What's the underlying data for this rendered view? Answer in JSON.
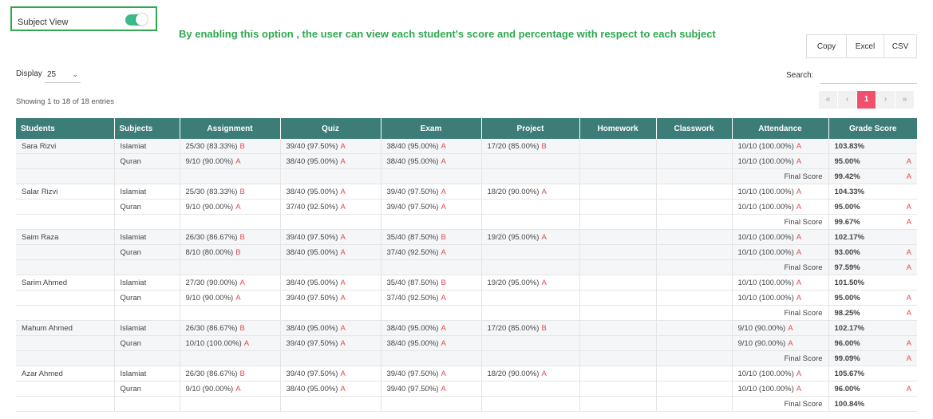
{
  "subject_view": {
    "label": "Subject View",
    "enabled": true
  },
  "annotation": "By enabling this option , the user can view each student's score and percentage with respect to each subject",
  "export": {
    "copy": "Copy",
    "excel": "Excel",
    "csv": "CSV"
  },
  "display": {
    "label": "Display",
    "value": "25"
  },
  "search": {
    "label": "Search:",
    "value": ""
  },
  "entries_info": "Showing 1 to 18 of 18 entries",
  "pagination": {
    "first": "«",
    "prev": "‹",
    "current": "1",
    "next": "›",
    "last": "»"
  },
  "colors": {
    "header_bg": "#3d7d78",
    "accent_green": "#3dba8a",
    "grade_red": "#e5484d",
    "active_page": "#f0506e"
  },
  "table": {
    "headers": [
      "Students",
      "Subjects",
      "Assignment",
      "Quiz",
      "Exam",
      "Project",
      "Homework",
      "Classwork",
      "Attendance",
      "Grade Score"
    ],
    "final_label": "Final Score",
    "students": [
      {
        "name": "Sara Rizvi",
        "final_score": "99.42%",
        "final_grade": "A",
        "rows": [
          {
            "subject": "Islamiat",
            "assignment": "25/30 (83.33%)",
            "assignment_g": "B",
            "quiz": "39/40 (97.50%)",
            "quiz_g": "A",
            "exam": "38/40 (95.00%)",
            "exam_g": "A",
            "project": "17/20 (85.00%)",
            "project_g": "B",
            "attendance": "10/10 (100.00%)",
            "attendance_g": "A",
            "score": "103.83%",
            "grade": ""
          },
          {
            "subject": "Quran",
            "assignment": "9/10 (90.00%)",
            "assignment_g": "A",
            "quiz": "38/40 (95.00%)",
            "quiz_g": "A",
            "exam": "38/40 (95.00%)",
            "exam_g": "A",
            "project": "",
            "project_g": "",
            "attendance": "10/10 (100.00%)",
            "attendance_g": "A",
            "score": "95.00%",
            "grade": "A"
          }
        ]
      },
      {
        "name": "Salar Rizvi",
        "final_score": "99.67%",
        "final_grade": "A",
        "rows": [
          {
            "subject": "Islamiat",
            "assignment": "25/30 (83.33%)",
            "assignment_g": "B",
            "quiz": "38/40 (95.00%)",
            "quiz_g": "A",
            "exam": "39/40 (97.50%)",
            "exam_g": "A",
            "project": "18/20 (90.00%)",
            "project_g": "A",
            "attendance": "10/10 (100.00%)",
            "attendance_g": "A",
            "score": "104.33%",
            "grade": ""
          },
          {
            "subject": "Quran",
            "assignment": "9/10 (90.00%)",
            "assignment_g": "A",
            "quiz": "37/40 (92.50%)",
            "quiz_g": "A",
            "exam": "39/40 (97.50%)",
            "exam_g": "A",
            "project": "",
            "project_g": "",
            "attendance": "10/10 (100.00%)",
            "attendance_g": "A",
            "score": "95.00%",
            "grade": "A"
          }
        ]
      },
      {
        "name": "Saim Raza",
        "final_score": "97.59%",
        "final_grade": "A",
        "rows": [
          {
            "subject": "Islamiat",
            "assignment": "26/30 (86.67%)",
            "assignment_g": "B",
            "quiz": "39/40 (97.50%)",
            "quiz_g": "A",
            "exam": "35/40 (87.50%)",
            "exam_g": "B",
            "project": "19/20 (95.00%)",
            "project_g": "A",
            "attendance": "10/10 (100.00%)",
            "attendance_g": "A",
            "score": "102.17%",
            "grade": ""
          },
          {
            "subject": "Quran",
            "assignment": "8/10 (80.00%)",
            "assignment_g": "B",
            "quiz": "38/40 (95.00%)",
            "quiz_g": "A",
            "exam": "37/40 (92.50%)",
            "exam_g": "A",
            "project": "",
            "project_g": "",
            "attendance": "10/10 (100.00%)",
            "attendance_g": "A",
            "score": "93.00%",
            "grade": "A"
          }
        ]
      },
      {
        "name": "Sarim Ahmed",
        "final_score": "98.25%",
        "final_grade": "A",
        "rows": [
          {
            "subject": "Islamiat",
            "assignment": "27/30 (90.00%)",
            "assignment_g": "A",
            "quiz": "38/40 (95.00%)",
            "quiz_g": "A",
            "exam": "35/40 (87.50%)",
            "exam_g": "B",
            "project": "19/20 (95.00%)",
            "project_g": "A",
            "attendance": "10/10 (100.00%)",
            "attendance_g": "A",
            "score": "101.50%",
            "grade": ""
          },
          {
            "subject": "Quran",
            "assignment": "9/10 (90.00%)",
            "assignment_g": "A",
            "quiz": "39/40 (97.50%)",
            "quiz_g": "A",
            "exam": "37/40 (92.50%)",
            "exam_g": "A",
            "project": "",
            "project_g": "",
            "attendance": "10/10 (100.00%)",
            "attendance_g": "A",
            "score": "95.00%",
            "grade": "A"
          }
        ]
      },
      {
        "name": "Mahum Ahmed",
        "final_score": "99.09%",
        "final_grade": "A",
        "rows": [
          {
            "subject": "Islamiat",
            "assignment": "26/30 (86.67%)",
            "assignment_g": "B",
            "quiz": "38/40 (95.00%)",
            "quiz_g": "A",
            "exam": "38/40 (95.00%)",
            "exam_g": "A",
            "project": "17/20 (85.00%)",
            "project_g": "B",
            "attendance": "9/10 (90.00%)",
            "attendance_g": "A",
            "score": "102.17%",
            "grade": ""
          },
          {
            "subject": "Quran",
            "assignment": "10/10 (100.00%)",
            "assignment_g": "A",
            "quiz": "39/40 (97.50%)",
            "quiz_g": "A",
            "exam": "38/40 (95.00%)",
            "exam_g": "A",
            "project": "",
            "project_g": "",
            "attendance": "9/10 (90.00%)",
            "attendance_g": "A",
            "score": "96.00%",
            "grade": "A"
          }
        ]
      },
      {
        "name": "Azar Ahmed",
        "final_score": "100.84%",
        "final_grade": "",
        "rows": [
          {
            "subject": "Islamiat",
            "assignment": "26/30 (86.67%)",
            "assignment_g": "B",
            "quiz": "39/40 (97.50%)",
            "quiz_g": "A",
            "exam": "39/40 (97.50%)",
            "exam_g": "A",
            "project": "18/20 (90.00%)",
            "project_g": "A",
            "attendance": "10/10 (100.00%)",
            "attendance_g": "A",
            "score": "105.67%",
            "grade": ""
          },
          {
            "subject": "Quran",
            "assignment": "9/10 (90.00%)",
            "assignment_g": "A",
            "quiz": "38/40 (95.00%)",
            "quiz_g": "A",
            "exam": "39/40 (97.50%)",
            "exam_g": "A",
            "project": "",
            "project_g": "",
            "attendance": "10/10 (100.00%)",
            "attendance_g": "A",
            "score": "96.00%",
            "grade": "A"
          }
        ]
      }
    ]
  }
}
